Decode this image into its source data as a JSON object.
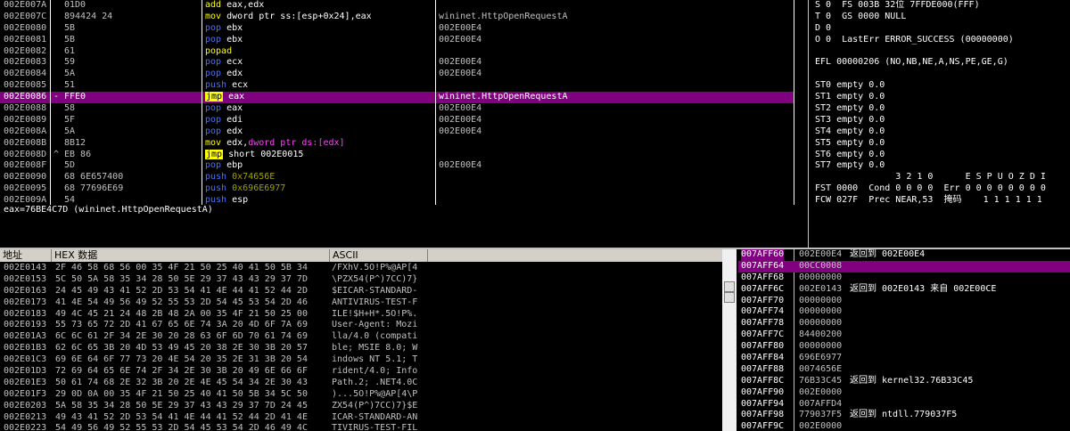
{
  "disasm": [
    {
      "addr": "002E007A",
      "mark": "",
      "hex": "01D0",
      "mn": "add",
      "mnc": "add",
      "ops": [
        {
          "t": "eax,edx",
          "c": "w"
        }
      ],
      "com": ""
    },
    {
      "addr": "002E007C",
      "mark": "",
      "hex": "894424 24",
      "mn": "mov",
      "mnc": "mov",
      "ops": [
        {
          "t": "dword ptr ss:[esp+0x24],eax",
          "c": "w"
        }
      ],
      "com": "wininet.HttpOpenRequestA"
    },
    {
      "addr": "002E0080",
      "mark": "",
      "hex": "5B",
      "mn": "pop",
      "mnc": "push",
      "ops": [
        {
          "t": "ebx",
          "c": "w"
        }
      ],
      "com": "002E00E4"
    },
    {
      "addr": "002E0081",
      "mark": "",
      "hex": "5B",
      "mn": "pop",
      "mnc": "push",
      "ops": [
        {
          "t": "ebx",
          "c": "w"
        }
      ],
      "com": "002E00E4"
    },
    {
      "addr": "002E0082",
      "mark": "",
      "hex": "61",
      "mn": "popad",
      "mnc": "popad",
      "ops": [],
      "com": ""
    },
    {
      "addr": "002E0083",
      "mark": "",
      "hex": "59",
      "mn": "pop",
      "mnc": "push",
      "ops": [
        {
          "t": "ecx",
          "c": "w"
        }
      ],
      "com": "002E00E4"
    },
    {
      "addr": "002E0084",
      "mark": "",
      "hex": "5A",
      "mn": "pop",
      "mnc": "push",
      "ops": [
        {
          "t": "edx",
          "c": "w"
        }
      ],
      "com": "002E00E4"
    },
    {
      "addr": "002E0085",
      "mark": "",
      "hex": "51",
      "mn": "push",
      "mnc": "push",
      "ops": [
        {
          "t": "ecx",
          "c": "w"
        }
      ],
      "com": ""
    },
    {
      "addr": "002E0086",
      "mark": "-",
      "hex": "FFE0",
      "mn": "jmp",
      "mnc": "jmp",
      "ops": [
        {
          "t": "eax",
          "c": "w"
        }
      ],
      "com": "wininet.HttpOpenRequestA",
      "sel": true
    },
    {
      "addr": "002E0088",
      "mark": "",
      "hex": "58",
      "mn": "pop",
      "mnc": "push",
      "ops": [
        {
          "t": "eax",
          "c": "w"
        }
      ],
      "com": "002E00E4"
    },
    {
      "addr": "002E0089",
      "mark": "",
      "hex": "5F",
      "mn": "pop",
      "mnc": "push",
      "ops": [
        {
          "t": "edi",
          "c": "w"
        }
      ],
      "com": "002E00E4"
    },
    {
      "addr": "002E008A",
      "mark": "",
      "hex": "5A",
      "mn": "pop",
      "mnc": "push",
      "ops": [
        {
          "t": "edx",
          "c": "w"
        }
      ],
      "com": "002E00E4"
    },
    {
      "addr": "002E008B",
      "mark": "",
      "hex": "8B12",
      "mn": "mov",
      "mnc": "mov",
      "ops": [
        {
          "t": "edx,",
          "c": "w"
        },
        {
          "t": "dword ptr ds:[edx]",
          "c": "m"
        }
      ],
      "com": ""
    },
    {
      "addr": "002E008D",
      "mark": "^",
      "hex": "EB 86",
      "mn": "jmp",
      "mnc": "jmp",
      "ops": [
        {
          "t": "short 002E0015",
          "c": "w"
        }
      ],
      "com": ""
    },
    {
      "addr": "002E008F",
      "mark": "",
      "hex": "5D",
      "mn": "pop",
      "mnc": "push",
      "ops": [
        {
          "t": "ebp",
          "c": "w"
        }
      ],
      "com": "002E00E4"
    },
    {
      "addr": "002E0090",
      "mark": "",
      "hex": "68 6E657400",
      "mn": "push",
      "mnc": "push",
      "ops": [
        {
          "t": "0x74656E",
          "c": "c"
        }
      ],
      "com": ""
    },
    {
      "addr": "002E0095",
      "mark": "",
      "hex": "68 77696E69",
      "mn": "push",
      "mnc": "push",
      "ops": [
        {
          "t": "0x696E6977",
          "c": "c"
        }
      ],
      "com": ""
    },
    {
      "addr": "002E009A",
      "mark": "",
      "hex": "54",
      "mn": "push",
      "mnc": "push",
      "ops": [
        {
          "t": "esp",
          "c": "w"
        }
      ],
      "com": ""
    }
  ],
  "info_line": "eax=76BE4C7D (wininet.HttpOpenRequestA)",
  "registers": [
    "S 0  FS 003B 32位 7FFDE000(FFF)",
    "T 0  GS 0000 NULL",
    "D 0",
    "O 0  LastErr ERROR_SUCCESS (00000000)",
    "",
    "EFL 00000206 (NO,NB,NE,A,NS,PE,GE,G)",
    "",
    "ST0 empty 0.0",
    "ST1 empty 0.0",
    "ST2 empty 0.0",
    "ST3 empty 0.0",
    "ST4 empty 0.0",
    "ST5 empty 0.0",
    "ST6 empty 0.0",
    "ST7 empty 0.0",
    "               3 2 1 0      E S P U O Z D I",
    "FST 0000  Cond 0 0 0 0  Err 0 0 0 0 0 0 0 0",
    "FCW 027F  Prec NEAR,53  掩码    1 1 1 1 1 1"
  ],
  "dump_head": {
    "addr": "地址",
    "hex": "HEX 数据",
    "ascii": "ASCII"
  },
  "dump": [
    {
      "addr": "002E0143",
      "hex": "2F 46 58 68 56 00 35 4F 21 50 25 40 41 50 5B 34",
      "ascii": "/FXhV.5O!P%@AP[4"
    },
    {
      "addr": "002E0153",
      "hex": "5C 50 5A 58 35 34 28 50 5E 29 37 43 43 29 37 7D",
      "ascii": "\\PZX54(P^)7CC)7}"
    },
    {
      "addr": "002E0163",
      "hex": "24 45 49 43 41 52 2D 53 54 41 4E 44 41 52 44 2D",
      "ascii": "$EICAR-STANDARD-"
    },
    {
      "addr": "002E0173",
      "hex": "41 4E 54 49 56 49 52 55 53 2D 54 45 53 54 2D 46",
      "ascii": "ANTIVIRUS-TEST-F"
    },
    {
      "addr": "002E0183",
      "hex": "49 4C 45 21 24 48 2B 48 2A 00 35 4F 21 50 25 00",
      "ascii": "ILE!$H+H*.5O!P%."
    },
    {
      "addr": "002E0193",
      "hex": "55 73 65 72 2D 41 67 65 6E 74 3A 20 4D 6F 7A 69",
      "ascii": "User-Agent: Mozi"
    },
    {
      "addr": "002E01A3",
      "hex": "6C 6C 61 2F 34 2E 30 20 28 63 6F 6D 70 61 74 69",
      "ascii": "lla/4.0 (compati"
    },
    {
      "addr": "002E01B3",
      "hex": "62 6C 65 3B 20 4D 53 49 45 20 38 2E 30 3B 20 57",
      "ascii": "ble; MSIE 8.0; W"
    },
    {
      "addr": "002E01C3",
      "hex": "69 6E 64 6F 77 73 20 4E 54 20 35 2E 31 3B 20 54",
      "ascii": "indows NT 5.1; T"
    },
    {
      "addr": "002E01D3",
      "hex": "72 69 64 65 6E 74 2F 34 2E 30 3B 20 49 6E 66 6F",
      "ascii": "rident/4.0; Info"
    },
    {
      "addr": "002E01E3",
      "hex": "50 61 74 68 2E 32 3B 20 2E 4E 45 54 34 2E 30 43",
      "ascii": "Path.2; .NET4.0C"
    },
    {
      "addr": "002E01F3",
      "hex": "29 0D 0A 00 35 4F 21 50 25 40 41 50 5B 34 5C 50",
      "ascii": ")...5O!P%@AP[4\\P"
    },
    {
      "addr": "002E0203",
      "hex": "5A 58 35 34 28 50 5E 29 37 43 43 29 37 7D 24 45",
      "ascii": "ZX54(P^)7CC)7}$E"
    },
    {
      "addr": "002E0213",
      "hex": "49 43 41 52 2D 53 54 41 4E 44 41 52 44 2D 41 4E",
      "ascii": "ICAR-STANDARD-AN"
    },
    {
      "addr": "002E0223",
      "hex": "54 49 56 49 52 55 53 2D 54 45 53 54 2D 46 49 4C",
      "ascii": "TIVIRUS-TEST-FIL"
    }
  ],
  "stack": [
    {
      "addr": "007AFF60",
      "val": "002E00E4",
      "com": "返回到 002E00E4",
      "cur": true
    },
    {
      "addr": "007AFF64",
      "val": "00CC0008",
      "com": "",
      "sel": true
    },
    {
      "addr": "007AFF68",
      "val": "00000000",
      "com": ""
    },
    {
      "addr": "007AFF6C",
      "val": "002E0143",
      "com": "返回到 002E0143 来自 002E00CE"
    },
    {
      "addr": "007AFF70",
      "val": "00000000",
      "com": ""
    },
    {
      "addr": "007AFF74",
      "val": "00000000",
      "com": ""
    },
    {
      "addr": "007AFF78",
      "val": "00000000",
      "com": ""
    },
    {
      "addr": "007AFF7C",
      "val": "84400200",
      "com": ""
    },
    {
      "addr": "007AFF80",
      "val": "00000000",
      "com": ""
    },
    {
      "addr": "007AFF84",
      "val": "696E6977",
      "com": ""
    },
    {
      "addr": "007AFF88",
      "val": "0074656E",
      "com": ""
    },
    {
      "addr": "007AFF8C",
      "val": "76B33C45",
      "com": "返回到 kernel32.76B33C45"
    },
    {
      "addr": "007AFF90",
      "val": "002E0000",
      "com": ""
    },
    {
      "addr": "007AFF94",
      "val": "007AFFD4",
      "com": ""
    },
    {
      "addr": "007AFF98",
      "val": "779037F5",
      "com": "返回到 ntdll.779037F5"
    },
    {
      "addr": "007AFF9C",
      "val": "002E0000",
      "com": ""
    }
  ]
}
